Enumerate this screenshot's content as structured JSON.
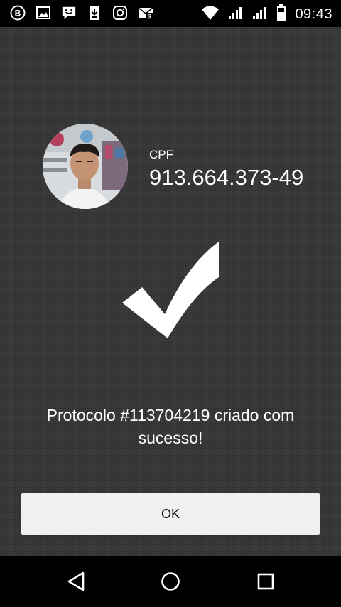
{
  "status_bar": {
    "time": "09:43",
    "icons": [
      "b-badge-icon",
      "image-notification-icon",
      "smiley-message-icon",
      "download-icon",
      "instagram-icon",
      "mail-notification-icon",
      "wifi-icon",
      "signal-icon",
      "signal-icon-2",
      "battery-icon"
    ]
  },
  "profile": {
    "cpf_label": "CPF",
    "cpf_value": "913.664.373-49",
    "avatar_icon": "user-photo"
  },
  "confirmation": {
    "icon": "checkmark-icon",
    "message_line1": "Protocolo #113704219 criado com",
    "message_line2": "sucesso!"
  },
  "actions": {
    "ok_label": "OK"
  },
  "nav_bar": {
    "icons": [
      "back-icon",
      "home-icon",
      "recents-icon"
    ]
  },
  "colors": {
    "background": "#3b3b3b",
    "text": "#ffffff",
    "button_bg": "#f0f0f0",
    "bars": "#000000"
  }
}
